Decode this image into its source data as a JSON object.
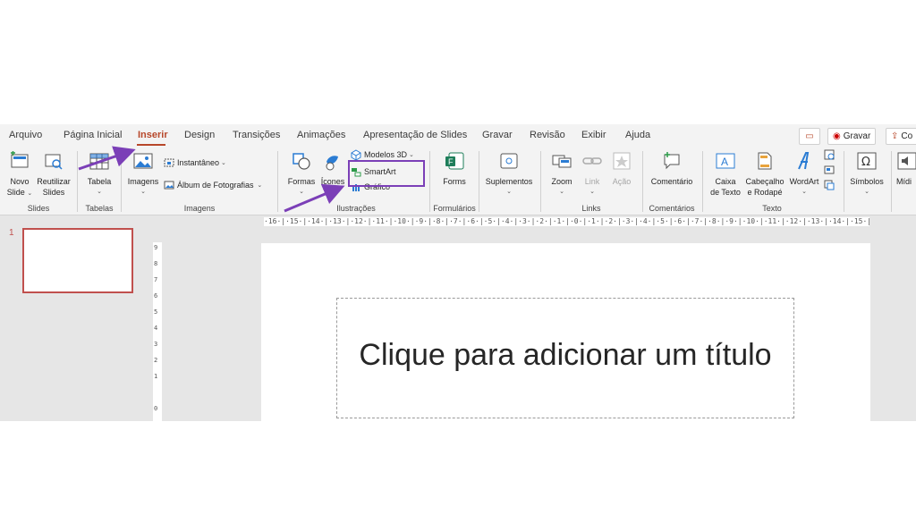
{
  "tabs": [
    "Arquivo",
    "Página Inicial",
    "Inserir",
    "Design",
    "Transições",
    "Animações",
    "Apresentação de Slides",
    "Gravar",
    "Revisão",
    "Exibir",
    "Ajuda"
  ],
  "active_tab": "Inserir",
  "title_bar_buttons": {
    "record": "Gravar",
    "comments_partial": "Co"
  },
  "ribbon": {
    "novo_slide": [
      "Novo",
      "Slide"
    ],
    "reutilizar": [
      "Reutilizar",
      "Slides"
    ],
    "tabela": "Tabela",
    "imagens": "Imagens",
    "instantaneo": "Instantâneo",
    "album": "Álbum de Fotografias",
    "formas": "Formas",
    "icones": "Ícones",
    "modelos3d": "Modelos 3D",
    "smartart": "SmartArt",
    "grafico": "Gráfico",
    "forms": "Forms",
    "suplementos": "Suplementos",
    "zoom": "Zoom",
    "link": "Link",
    "acao": "Ação",
    "comentario": "Comentário",
    "caixa_texto": [
      "Caixa",
      "de Texto"
    ],
    "cabecalho": [
      "Cabeçalho",
      "e Rodapé"
    ],
    "wordart": "WordArt",
    "simbolos": "Símbolos",
    "midia_partial": "Mídi",
    "groups": [
      "Slides",
      "Tabelas",
      "Imagens",
      "Ilustrações",
      "Formulários",
      "Links",
      "Comentários",
      "Texto"
    ]
  },
  "slide_number": "1",
  "ruler_text": "·16·|·15·|·14·|·13·|·12·|·11·|·10·|·9·|·8·|·7·|·6·|·5·|·4·|·3·|·2·|·1·|·0·|·1·|·2·|·3·|·4·|·5·|·6·|·7·|·8·|·9·|·10·|·11·|·12·|·13·|·14·|·15·|·16·",
  "vruler_numbers": [
    "9",
    "8",
    "7",
    "6",
    "5",
    "4",
    "3",
    "2",
    "1",
    "0"
  ],
  "placeholder_title": "Clique para adicionar um título",
  "colors": {
    "accent": "#b7472a",
    "annotation": "#7b3fb7",
    "thumb_border": "#c0504d"
  }
}
